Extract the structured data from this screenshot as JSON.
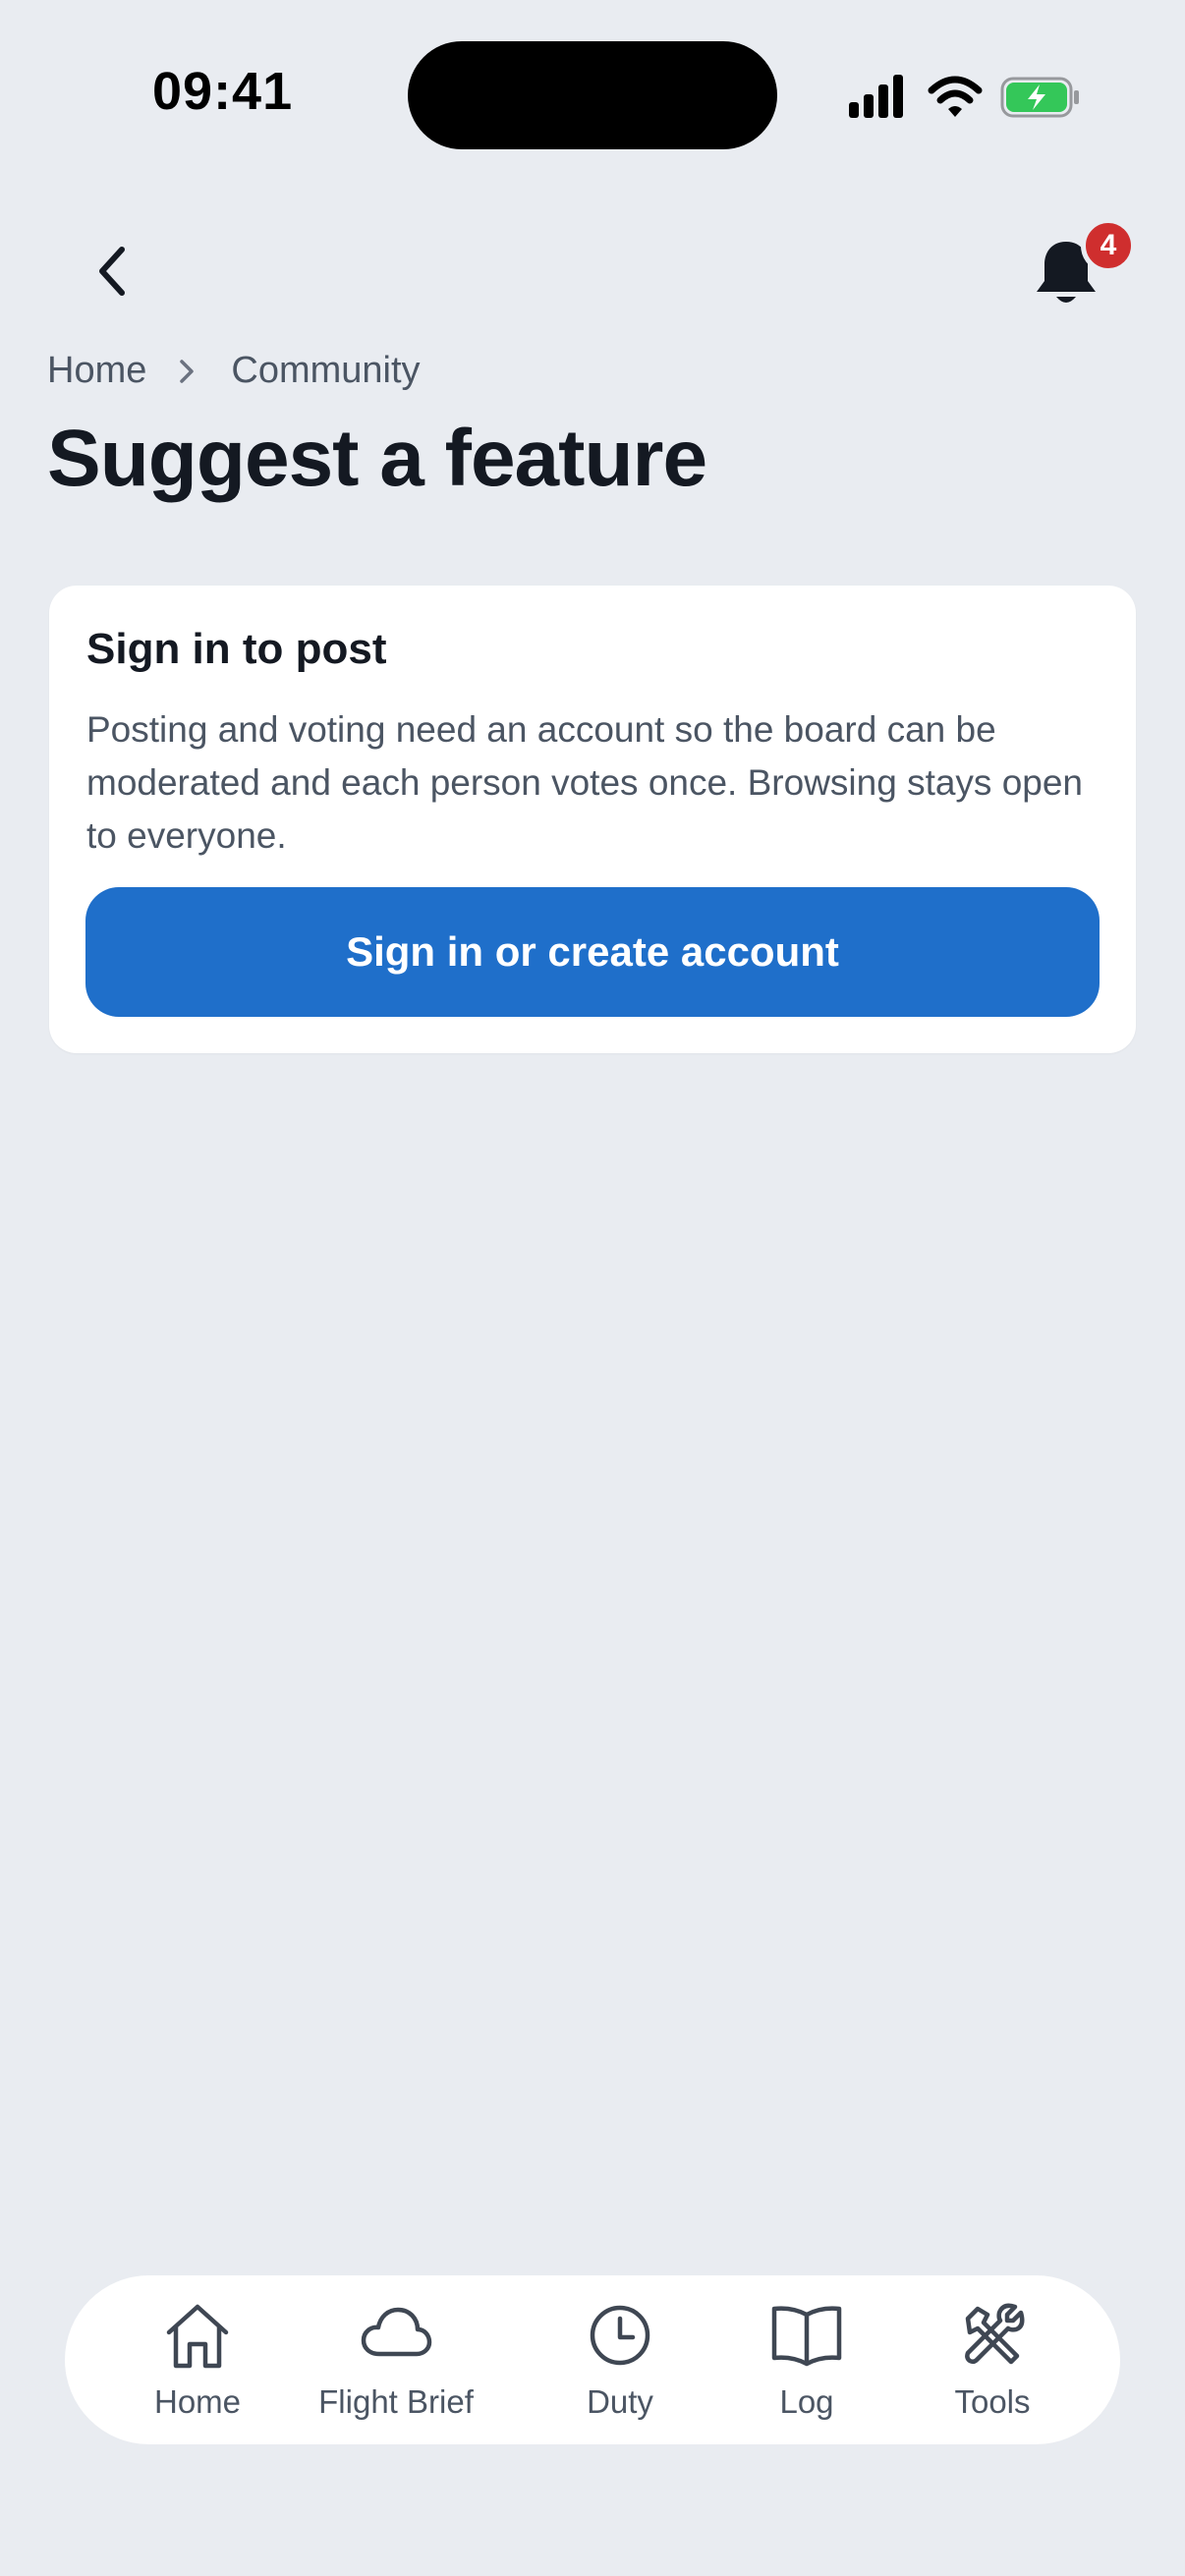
{
  "status_bar": {
    "time": "09:41"
  },
  "header": {
    "notification_count": "4"
  },
  "breadcrumb": {
    "items": [
      "Home",
      "Community"
    ]
  },
  "page": {
    "title": "Suggest a feature"
  },
  "card": {
    "title": "Sign in to post",
    "body": "Posting and voting need an account so the board can be moderated and each person votes once. Browsing stays open to everyone.",
    "button_label": "Sign in or create account"
  },
  "tabbar": {
    "tabs": [
      {
        "label": "Home",
        "icon": "home-icon"
      },
      {
        "label": "Flight Brief",
        "icon": "cloud-icon"
      },
      {
        "label": "Duty",
        "icon": "clock-icon"
      },
      {
        "label": "Log",
        "icon": "book-icon"
      },
      {
        "label": "Tools",
        "icon": "tools-icon"
      }
    ]
  },
  "colors": {
    "background": "#e9ecf1",
    "primary": "#1f6fca",
    "badge": "#cf2e2e",
    "battery": "#34c759"
  }
}
